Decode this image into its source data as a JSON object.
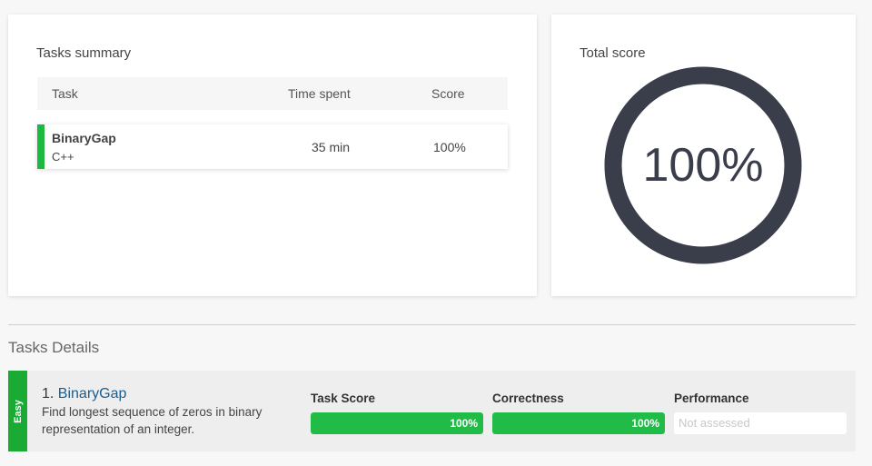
{
  "summary": {
    "title": "Tasks summary",
    "columns": {
      "task": "Task",
      "time": "Time spent",
      "score": "Score"
    },
    "rows": [
      {
        "name": "BinaryGap",
        "language": "C++",
        "time": "35 min",
        "score": "100%",
        "status_color": "#1db83f"
      }
    ]
  },
  "total": {
    "title": "Total score",
    "value": "100%",
    "fraction": 1.0,
    "ring_color": "#3a3d4a"
  },
  "details": {
    "title": "Tasks Details",
    "tasks": [
      {
        "difficulty": "Easy",
        "number": "1.",
        "name": "BinaryGap",
        "description": "Find longest sequence of zeros in binary representation of an integer.",
        "metrics": {
          "task_score": {
            "label": "Task Score",
            "value": "100%",
            "fraction": 1.0
          },
          "correctness": {
            "label": "Correctness",
            "value": "100%",
            "fraction": 1.0
          },
          "performance": {
            "label": "Performance",
            "value": "Not assessed"
          }
        }
      }
    ]
  },
  "colors": {
    "accent_green": "#21bc47",
    "link_blue": "#1a5e92",
    "easy_green": "#1aab35"
  }
}
